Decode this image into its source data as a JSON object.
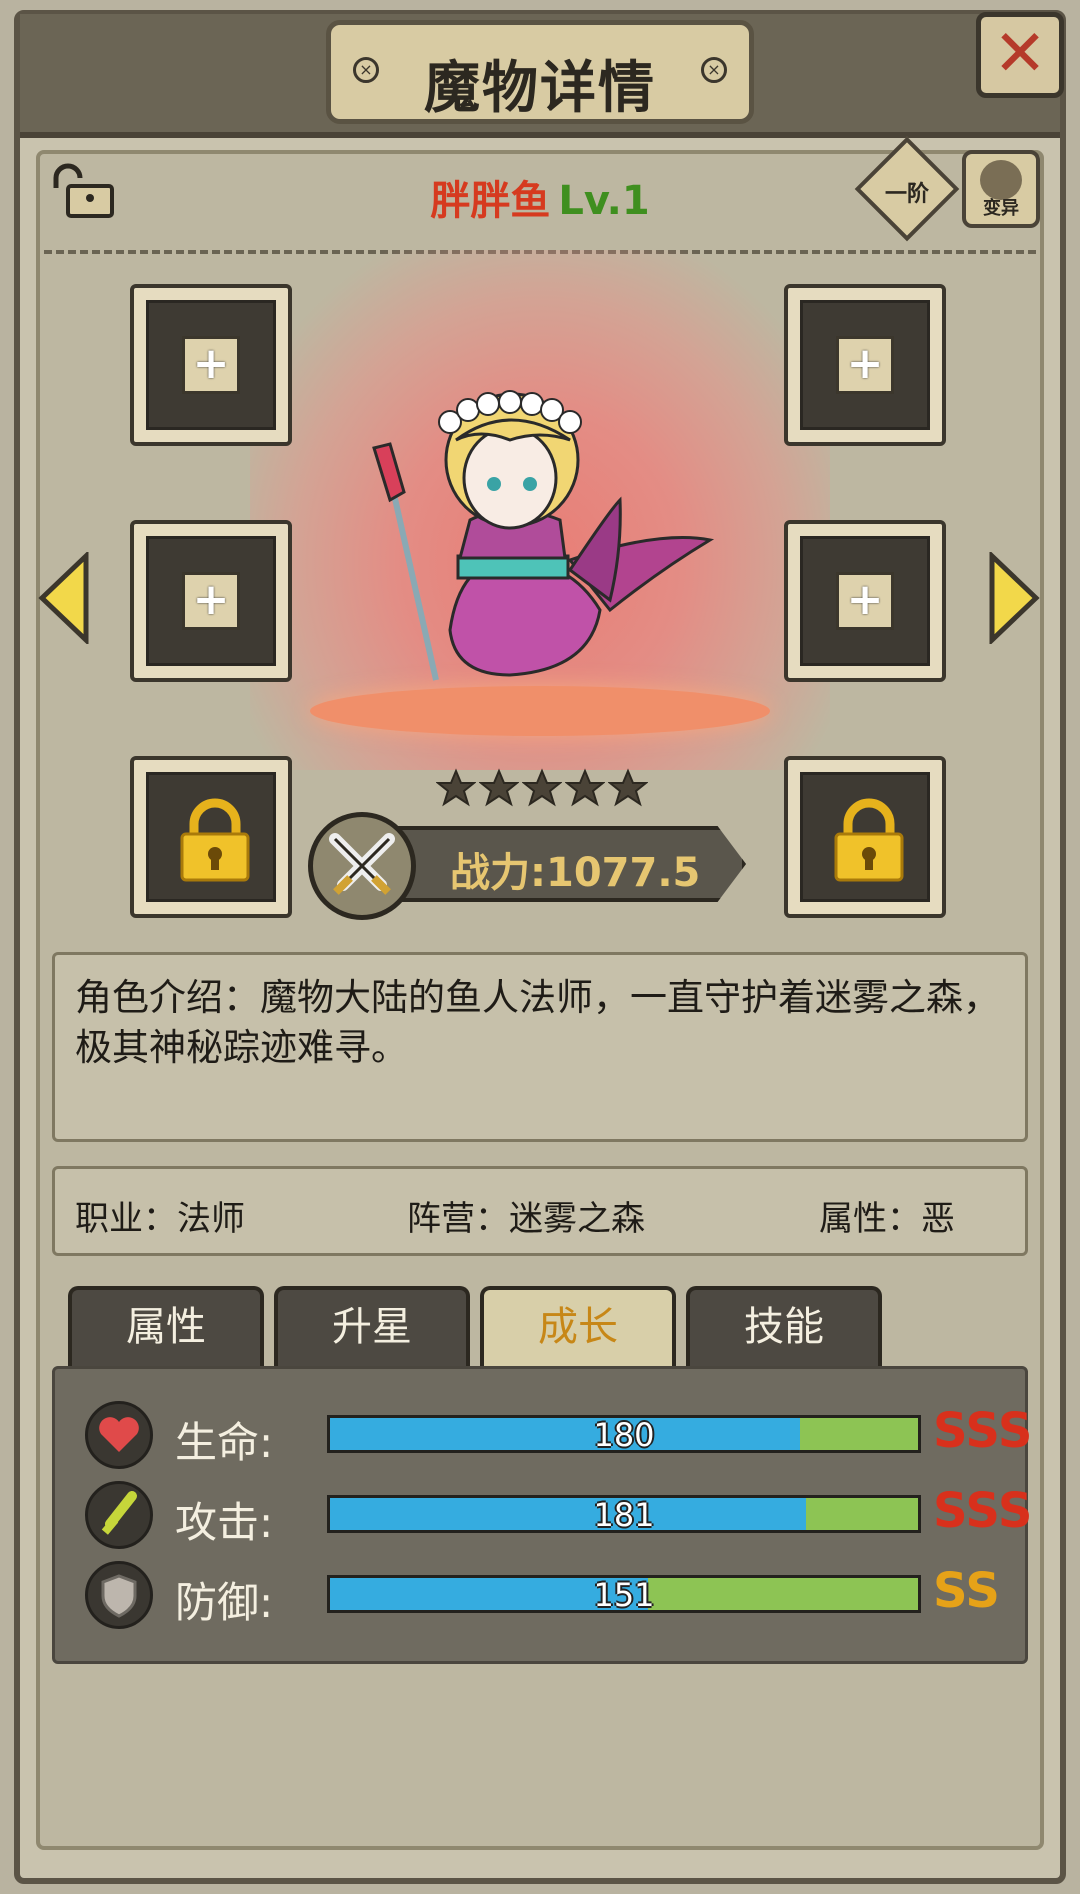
{
  "window": {
    "title": "魔物详情",
    "close_symbol": "✕"
  },
  "monster": {
    "name": "胖胖鱼",
    "level": "Lv.1",
    "rank": "一阶",
    "mutate_label": "变异",
    "stars": 5
  },
  "equipment": {
    "plus_symbol": "+"
  },
  "power": {
    "label": "战力:1077.5"
  },
  "description": "角色介绍：魔物大陆的鱼人法师，一直守护着迷雾之森，极其神秘踪迹难寻。",
  "info": {
    "job": "职业：法师",
    "faction": "阵营：迷雾之森",
    "attribute": "属性：恶"
  },
  "tabs": [
    {
      "label": "属性",
      "active": false
    },
    {
      "label": "升星",
      "active": false
    },
    {
      "label": "成长",
      "active": true
    },
    {
      "label": "技能",
      "active": false
    }
  ],
  "stats": [
    {
      "label": "生命:",
      "value": "180",
      "fill_pct": 80,
      "grade": "SSS",
      "icon": "heart-icon"
    },
    {
      "label": "攻击:",
      "value": "181",
      "fill_pct": 81,
      "grade": "SSS",
      "icon": "sword-icon"
    },
    {
      "label": "防御:",
      "value": "151",
      "fill_pct": 54,
      "grade": "SS",
      "icon": "shield-icon"
    }
  ],
  "colors": {
    "bar_fill": "#35ace0",
    "bar_bg": "#8dc454",
    "grade_sss": "#d8301c",
    "grade_ss": "#e6a218",
    "name": "#d63a1f",
    "level": "#3f8f1f"
  }
}
